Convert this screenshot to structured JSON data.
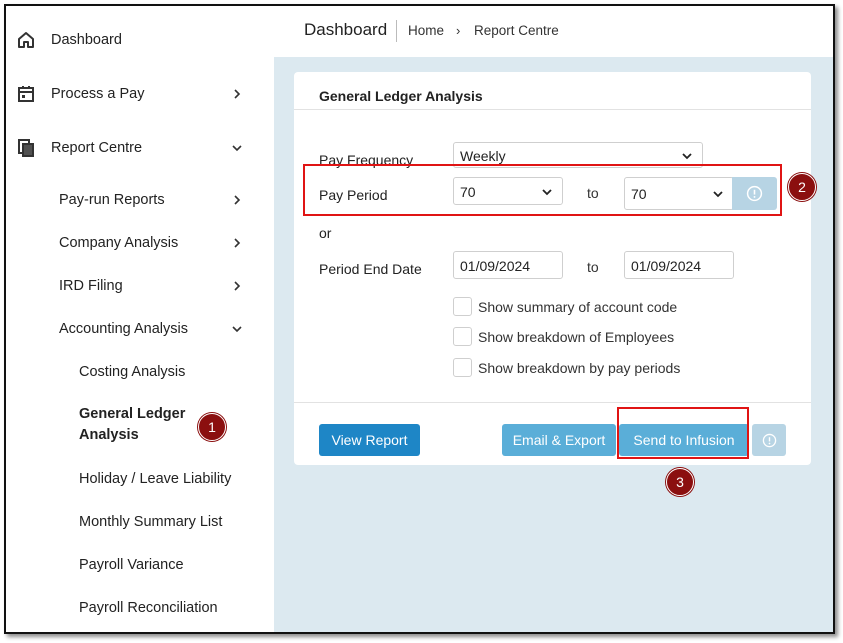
{
  "sidebar": {
    "dashboard": "Dashboard",
    "process_pay": "Process a Pay",
    "report_centre": "Report Centre",
    "sub": {
      "pay_run_reports": "Pay-run Reports",
      "company_analysis": "Company Analysis",
      "ird_filing": "IRD Filing",
      "accounting_analysis": "Accounting Analysis"
    },
    "sub2": {
      "costing_analysis": "Costing Analysis",
      "gl_analysis_line1": "General Ledger",
      "gl_analysis_line2": "Analysis",
      "holiday_leave": "Holiday / Leave Liability",
      "monthly_summary": "Monthly Summary List",
      "payroll_variance": "Payroll Variance",
      "payroll_reconciliation": "Payroll Reconciliation"
    }
  },
  "header": {
    "title": "Dashboard",
    "crumb_home": "Home",
    "crumb_sep": "›",
    "crumb_current": "Report Centre"
  },
  "card": {
    "title": "General Ledger Analysis",
    "pay_frequency_label": "Pay Frequency",
    "pay_frequency_value": "Weekly",
    "pay_period_label": "Pay Period",
    "pay_period_from": "70",
    "pay_period_to": "70",
    "to_text": "to",
    "or_text": "or",
    "period_end_label": "Period End Date",
    "period_end_from": "01/09/2024",
    "period_end_to": "01/09/2024",
    "checks": [
      "Show summary of account code",
      "Show breakdown of Employees",
      "Show breakdown by pay periods"
    ],
    "view_report": "View Report",
    "email_export": "Email & Export",
    "send_infusion": "Send to Infusion"
  },
  "annotations": {
    "badge1": "1",
    "badge2": "2",
    "badge3": "3"
  },
  "colors": {
    "primary": "#1e86c6",
    "highlight": "#e01414",
    "badge": "#8b0f0f",
    "main_bg": "#dce9f0"
  }
}
